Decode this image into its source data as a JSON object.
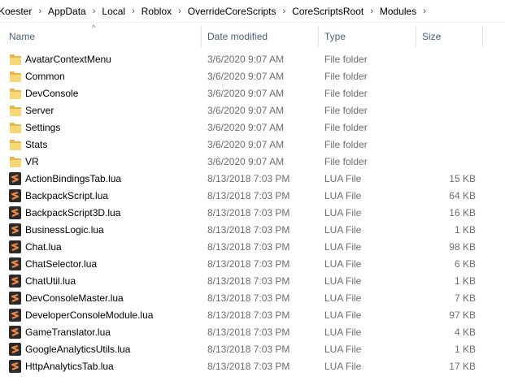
{
  "breadcrumb": [
    "Koester",
    "AppData",
    "Local",
    "Roblox",
    "OverrideCoreScripts",
    "CoreScriptsRoot",
    "Modules"
  ],
  "breadcrumb_separator": "›",
  "columns": {
    "sort_indicator": "^",
    "name": "Name",
    "date": "Date modified",
    "type": "Type",
    "size": "Size"
  },
  "files": [
    {
      "name": "AvatarContextMenu",
      "date": "3/6/2020 9:07 AM",
      "type": "File folder",
      "size": "",
      "icon": "folder-icon"
    },
    {
      "name": "Common",
      "date": "3/6/2020 9:07 AM",
      "type": "File folder",
      "size": "",
      "icon": "folder-icon"
    },
    {
      "name": "DevConsole",
      "date": "3/6/2020 9:07 AM",
      "type": "File folder",
      "size": "",
      "icon": "folder-icon"
    },
    {
      "name": "Server",
      "date": "3/6/2020 9:07 AM",
      "type": "File folder",
      "size": "",
      "icon": "folder-icon"
    },
    {
      "name": "Settings",
      "date": "3/6/2020 9:07 AM",
      "type": "File folder",
      "size": "",
      "icon": "folder-icon"
    },
    {
      "name": "Stats",
      "date": "3/6/2020 9:07 AM",
      "type": "File folder",
      "size": "",
      "icon": "folder-icon"
    },
    {
      "name": "VR",
      "date": "3/6/2020 9:07 AM",
      "type": "File folder",
      "size": "",
      "icon": "folder-icon"
    },
    {
      "name": "ActionBindingsTab.lua",
      "date": "8/13/2018 7:03 PM",
      "type": "LUA File",
      "size": "15 KB",
      "icon": "lua-file-icon"
    },
    {
      "name": "BackpackScript.lua",
      "date": "8/13/2018 7:03 PM",
      "type": "LUA File",
      "size": "64 KB",
      "icon": "lua-file-icon"
    },
    {
      "name": "BackpackScript3D.lua",
      "date": "8/13/2018 7:03 PM",
      "type": "LUA File",
      "size": "16 KB",
      "icon": "lua-file-icon"
    },
    {
      "name": "BusinessLogic.lua",
      "date": "8/13/2018 7:03 PM",
      "type": "LUA File",
      "size": "1 KB",
      "icon": "lua-file-icon"
    },
    {
      "name": "Chat.lua",
      "date": "8/13/2018 7:03 PM",
      "type": "LUA File",
      "size": "98 KB",
      "icon": "lua-file-icon"
    },
    {
      "name": "ChatSelector.lua",
      "date": "8/13/2018 7:03 PM",
      "type": "LUA File",
      "size": "6 KB",
      "icon": "lua-file-icon"
    },
    {
      "name": "ChatUtil.lua",
      "date": "8/13/2018 7:03 PM",
      "type": "LUA File",
      "size": "1 KB",
      "icon": "lua-file-icon"
    },
    {
      "name": "DevConsoleMaster.lua",
      "date": "8/13/2018 7:03 PM",
      "type": "LUA File",
      "size": "7 KB",
      "icon": "lua-file-icon"
    },
    {
      "name": "DeveloperConsoleModule.lua",
      "date": "8/13/2018 7:03 PM",
      "type": "LUA File",
      "size": "97 KB",
      "icon": "lua-file-icon"
    },
    {
      "name": "GameTranslator.lua",
      "date": "8/13/2018 7:03 PM",
      "type": "LUA File",
      "size": "4 KB",
      "icon": "lua-file-icon"
    },
    {
      "name": "GoogleAnalyticsUtils.lua",
      "date": "8/13/2018 7:03 PM",
      "type": "LUA File",
      "size": "1 KB",
      "icon": "lua-file-icon"
    },
    {
      "name": "HttpAnalyticsTab.lua",
      "date": "8/13/2018 7:03 PM",
      "type": "LUA File",
      "size": "17 KB",
      "icon": "lua-file-icon"
    }
  ],
  "colors": {
    "header_text": "#4c607a",
    "secondary_text": "#6d6d6d",
    "folder_front": "#f8d775",
    "folder_back": "#e8b64a",
    "lua_icon_bg": "#2b2b2b",
    "lua_icon_accent": "#f0883e"
  }
}
